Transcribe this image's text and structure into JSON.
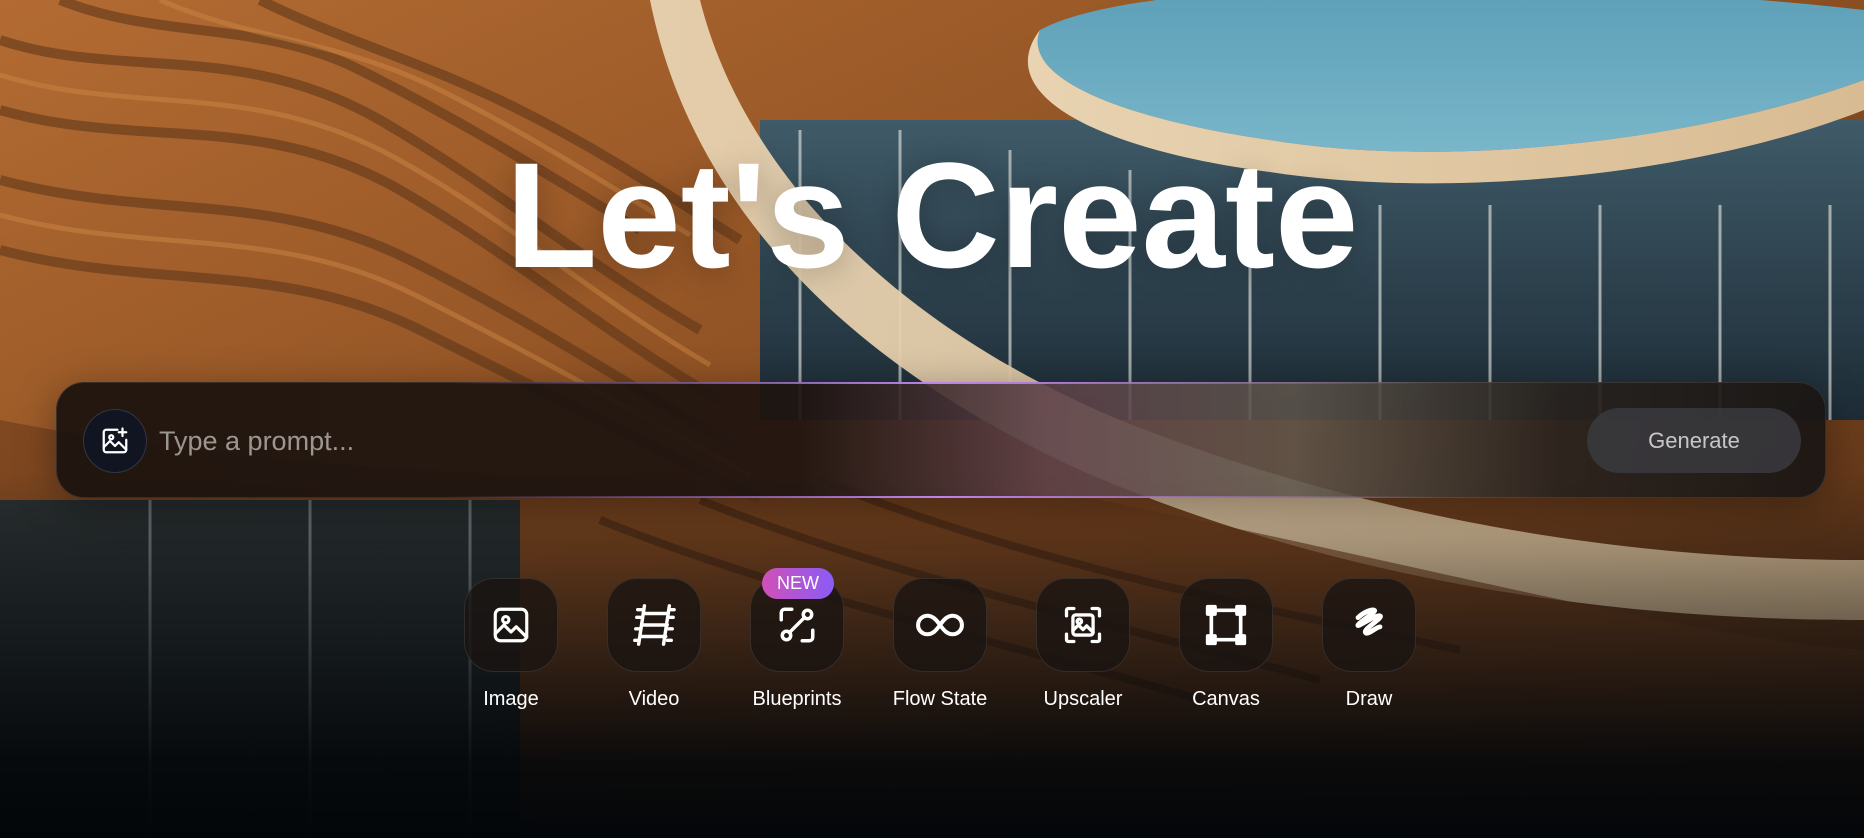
{
  "hero": {
    "title": "Let's Create"
  },
  "prompt": {
    "icon": "image-plus-icon",
    "placeholder": "Type a prompt...",
    "value": "",
    "generate_label": "Generate"
  },
  "tools": [
    {
      "label": "Image",
      "icon": "image-icon"
    },
    {
      "label": "Video",
      "icon": "film-icon"
    },
    {
      "label": "Blueprints",
      "icon": "blueprint-icon",
      "badge": "NEW"
    },
    {
      "label": "Flow State",
      "icon": "infinity-icon"
    },
    {
      "label": "Upscaler",
      "icon": "upscale-icon"
    },
    {
      "label": "Canvas",
      "icon": "canvas-icon"
    },
    {
      "label": "Draw",
      "icon": "scribble-icon"
    }
  ],
  "colors": {
    "badge_gradient_start": "#d050b8",
    "badge_gradient_end": "#8a5cf6",
    "generate_bg": "#3a3a3e",
    "sky": "#6aa8c0",
    "wood": "#a7632c"
  }
}
